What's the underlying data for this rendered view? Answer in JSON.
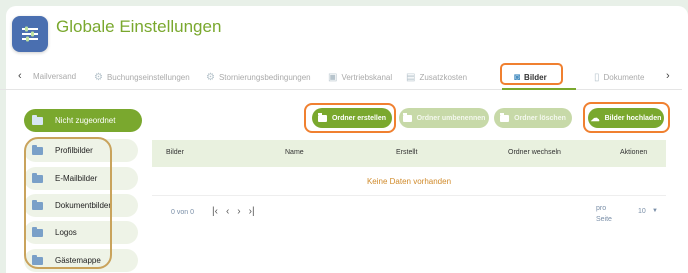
{
  "header": {
    "title": "Globale Einstellungen"
  },
  "tabs": [
    {
      "label": "Mailversand",
      "icon": "mail-icon"
    },
    {
      "label": "Buchungseinstellungen",
      "icon": "gear-icon"
    },
    {
      "label": "Stornierungsbedingungen",
      "icon": "settings-cycle-icon"
    },
    {
      "label": "Vertriebskanal",
      "icon": "channel-icon"
    },
    {
      "label": "Zusatzkosten",
      "icon": "costs-icon"
    },
    {
      "label": "Bilder",
      "icon": "camera-icon",
      "active": true
    },
    {
      "label": "Dokumente",
      "icon": "document-icon"
    }
  ],
  "sidebar": {
    "items": [
      {
        "label": "Nicht zugeordnet",
        "active": true
      },
      {
        "label": "Profilbilder"
      },
      {
        "label": "E-Mailbilder"
      },
      {
        "label": "Dokumentbilder"
      },
      {
        "label": "Logos"
      },
      {
        "label": "Gästemappe"
      }
    ]
  },
  "actions": {
    "create_folder": "Ordner erstellen",
    "rename_folder": "Ordner umbenennen",
    "delete_folder": "Ordner löschen",
    "upload_images": "Bilder hochladen"
  },
  "table": {
    "columns": [
      "Bilder",
      "Name",
      "Erstellt",
      "Ordner wechseln",
      "Aktionen"
    ],
    "empty_message": "Keine Daten vorhanden"
  },
  "pager": {
    "count": "0 von 0",
    "per_page_label": "pro Seite",
    "per_page_value": "10"
  },
  "colors": {
    "accent": "#7aa82e",
    "highlight": "#f08030",
    "title": "#7aa82e"
  }
}
